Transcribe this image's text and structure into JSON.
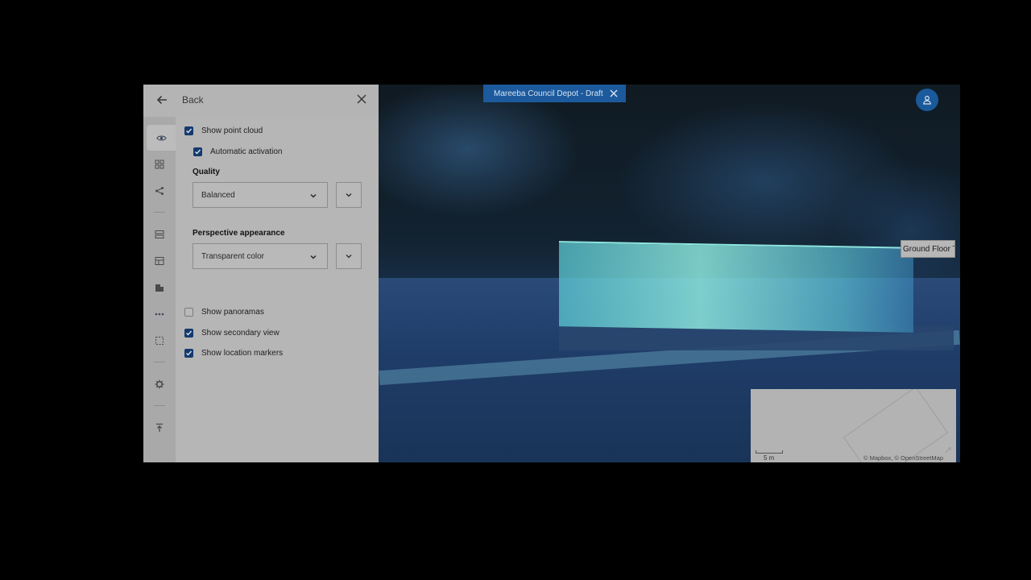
{
  "panel": {
    "back_label": "Back",
    "rail_items": [
      "eye-icon",
      "grid-icon",
      "share-icon",
      "layers-icon",
      "table-icon",
      "building-icon",
      "more-icon",
      "selection-icon",
      "gear-icon",
      "upload-icon"
    ],
    "options": {
      "show_point_cloud": {
        "label": "Show point cloud",
        "checked": true
      },
      "automatic_activation": {
        "label": "Automatic activation",
        "checked": true
      },
      "quality_title": "Quality",
      "quality_value": "Balanced",
      "perspective_title": "Perspective appearance",
      "perspective_value": "Transparent color",
      "show_panoramas": {
        "label": "Show panoramas",
        "checked": false
      },
      "show_secondary_view": {
        "label": "Show secondary view",
        "checked": true
      },
      "show_location_markers": {
        "label": "Show location markers",
        "checked": true
      }
    }
  },
  "viewport": {
    "project_tab": "Mareeba Council Depot - Draft",
    "floor_label": "Ground Floor T",
    "minimap": {
      "scale_label": "5 m",
      "attribution": "© Mapbox, © OpenStreetMap"
    }
  },
  "colors": {
    "accent": "#1c5a9d",
    "checkbox": "#143a6e",
    "panel_bg": "#b6b6b6"
  }
}
